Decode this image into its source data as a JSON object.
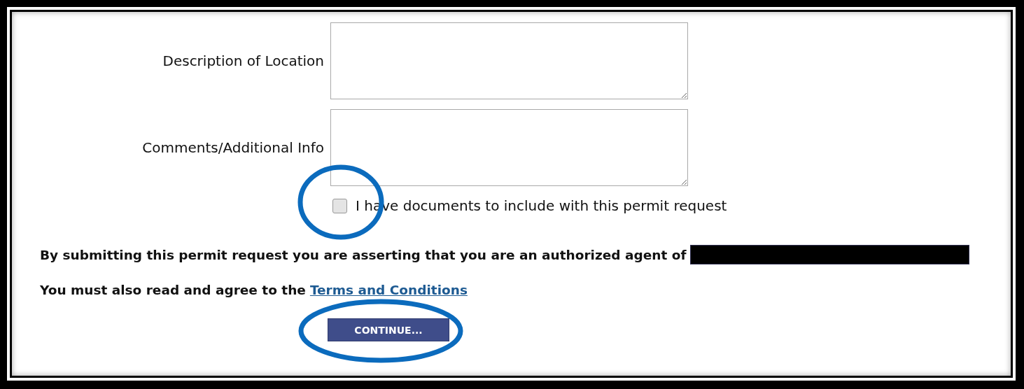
{
  "fields": [
    {
      "label": "Description of Location"
    },
    {
      "label": "Comments/Additional Info"
    }
  ],
  "documents_checkbox": {
    "label": "I have documents to include with this permit request",
    "checked": false
  },
  "agent_statement": "By submitting this permit request you are asserting that you are an authorized agent of",
  "terms": {
    "text": "You must also read and agree to the",
    "link": "Terms and Conditions"
  },
  "buttons": [
    "CONTINUE..."
  ]
}
